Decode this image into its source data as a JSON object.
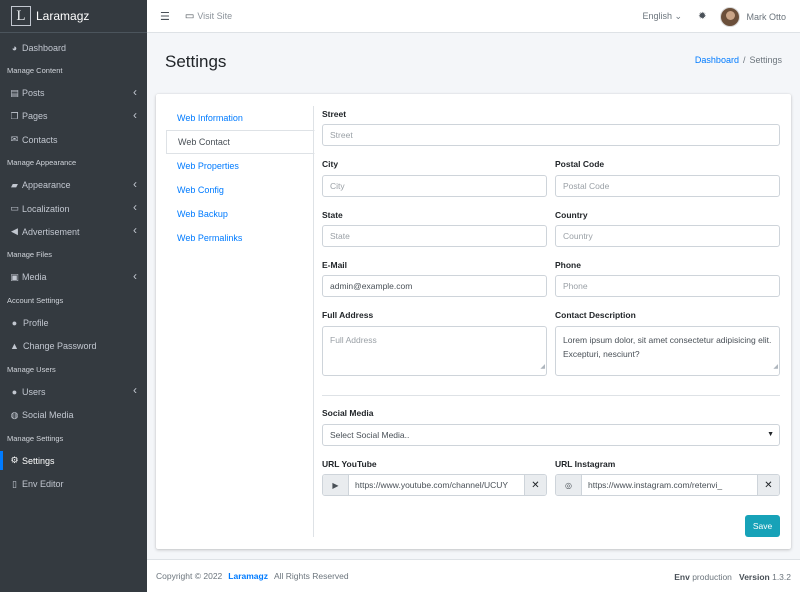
{
  "brand": {
    "logo_letter": "L",
    "name": "Laramagz"
  },
  "sidebar": {
    "items": [
      {
        "type": "item",
        "icon": "dashboard-icon",
        "glyph": "◕",
        "label": "Dashboard",
        "arrow": false
      },
      {
        "type": "header",
        "label": "Manage Content"
      },
      {
        "type": "item",
        "icon": "posts-icon",
        "glyph": "▤",
        "label": "Posts",
        "arrow": true
      },
      {
        "type": "item",
        "icon": "pages-icon",
        "glyph": "❐",
        "label": "Pages",
        "arrow": true
      },
      {
        "type": "item",
        "icon": "envelope-icon",
        "glyph": "✉",
        "label": "Contacts",
        "arrow": false
      },
      {
        "type": "header",
        "label": "Manage Appearance"
      },
      {
        "type": "item",
        "icon": "paint-roller-icon",
        "glyph": "▰",
        "label": "Appearance",
        "arrow": true
      },
      {
        "type": "item",
        "icon": "language-icon",
        "glyph": "▭",
        "label": "Localization",
        "arrow": true
      },
      {
        "type": "item",
        "icon": "bullhorn-icon",
        "glyph": "◀",
        "label": "Advertisement",
        "arrow": true
      },
      {
        "type": "header",
        "label": "Manage Files"
      },
      {
        "type": "item",
        "icon": "photo-icon",
        "glyph": "▣",
        "label": "Media",
        "arrow": true
      },
      {
        "type": "header",
        "label": "Account Settings"
      },
      {
        "type": "item",
        "icon": "user-icon",
        "glyph": "●",
        "label": "Profile",
        "arrow": false,
        "sub": true
      },
      {
        "type": "item",
        "icon": "lock-icon",
        "glyph": "▲",
        "label": "Change Password",
        "arrow": false,
        "sub": true
      },
      {
        "type": "header",
        "label": "Manage Users"
      },
      {
        "type": "item",
        "icon": "users-icon",
        "glyph": "●",
        "label": "Users",
        "arrow": true
      },
      {
        "type": "item",
        "icon": "globe-icon",
        "glyph": "◍",
        "label": "Social Media",
        "arrow": false
      },
      {
        "type": "header",
        "label": "Manage Settings"
      },
      {
        "type": "item",
        "icon": "cogs-icon",
        "glyph": "⚙",
        "label": "Settings",
        "arrow": false,
        "active": true
      },
      {
        "type": "item",
        "icon": "file-icon",
        "glyph": "▯",
        "label": "Env Editor",
        "arrow": false
      }
    ]
  },
  "topbar": {
    "visit_label": "Visit Site",
    "language": "English",
    "user_name": "Mark Otto"
  },
  "page": {
    "title": "Settings",
    "breadcrumb_home": "Dashboard",
    "breadcrumb_current": "Settings"
  },
  "tabs": [
    "Web Information",
    "Web Contact",
    "Web Properties",
    "Web Config",
    "Web Backup",
    "Web Permalinks"
  ],
  "form": {
    "street_label": "Street",
    "street_placeholder": "Street",
    "city_label": "City",
    "city_placeholder": "City",
    "postal_label": "Postal Code",
    "postal_placeholder": "Postal Code",
    "state_label": "State",
    "state_placeholder": "State",
    "country_label": "Country",
    "country_placeholder": "Country",
    "email_label": "E-Mail",
    "email_value": "admin@example.com",
    "phone_label": "Phone",
    "phone_placeholder": "Phone",
    "full_address_label": "Full Address",
    "full_address_placeholder": "Full Address",
    "contact_desc_label": "Contact Description",
    "contact_desc_value": "Lorem ipsum dolor, sit amet consectetur adipisicing elit. Excepturi, nesciunt?",
    "social_label": "Social Media",
    "social_selected": "Select Social Media..",
    "youtube_label": "URL YouTube",
    "youtube_value": "https://www.youtube.com/channel/UCUY",
    "instagram_label": "URL Instagram",
    "instagram_value": "https://www.instagram.com/retenvi_",
    "save_label": "Save"
  },
  "footer": {
    "copyright": "Copyright © 2022",
    "brand": "Laramagz",
    "rights": "All Rights Reserved",
    "env_label": "Env",
    "env_value": "production",
    "version_label": "Version",
    "version_value": "1.3.2"
  },
  "colors": {
    "sidebar": "#343a40",
    "accent": "#007bff",
    "save": "#17a2b8"
  }
}
